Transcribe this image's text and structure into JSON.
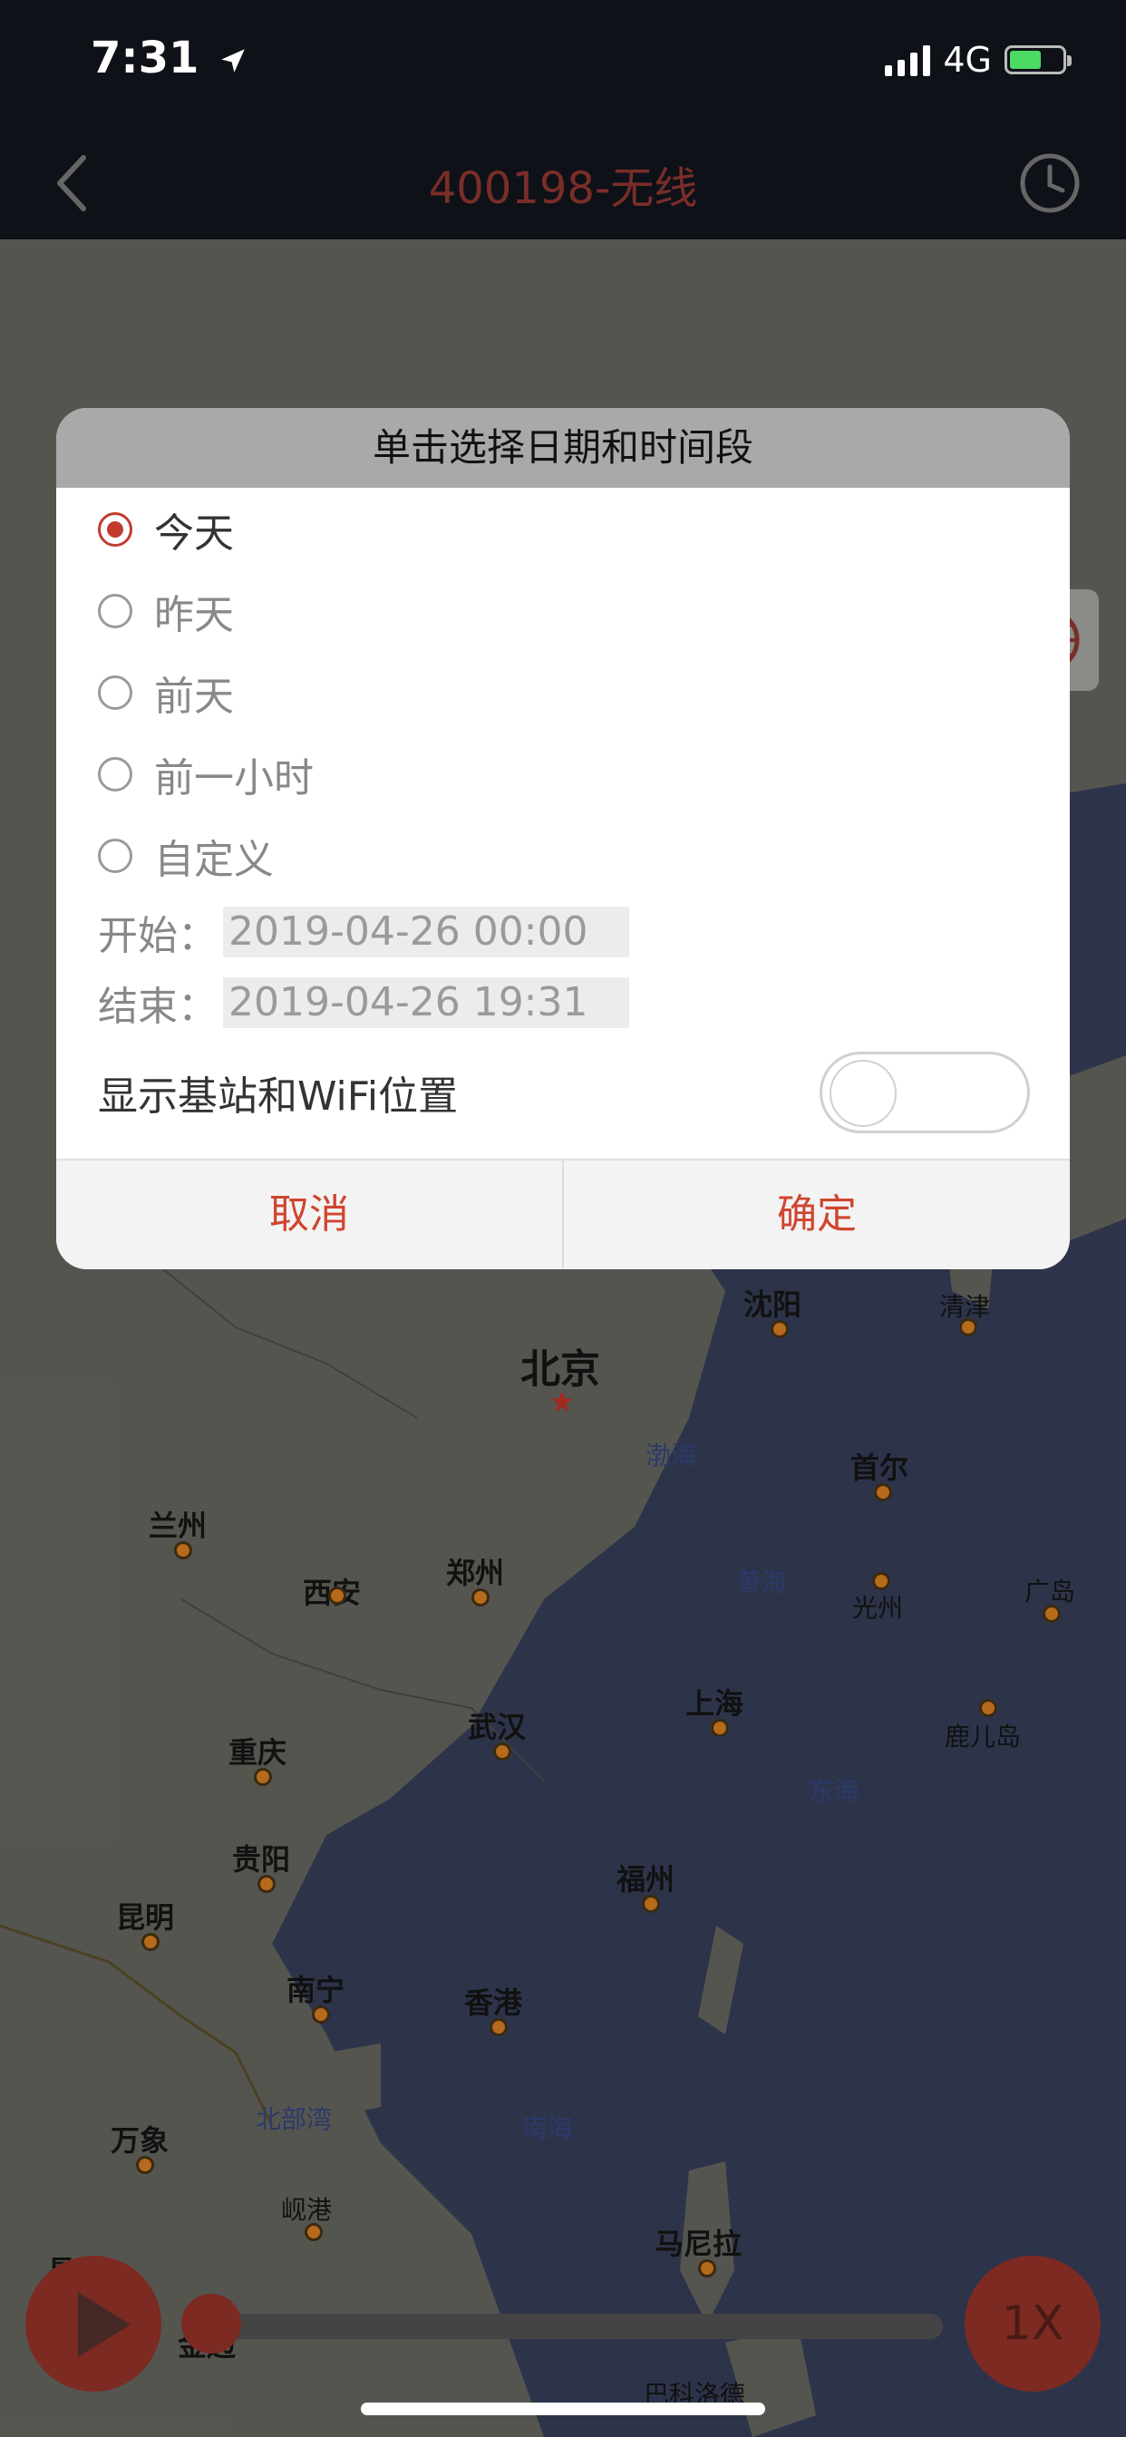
{
  "status_bar": {
    "time": "7:31",
    "network": "4G"
  },
  "nav": {
    "title": "400198-无线"
  },
  "dialog": {
    "title": "单击选择日期和时间段",
    "options": [
      {
        "label": "今天",
        "selected": true
      },
      {
        "label": "昨天",
        "selected": false
      },
      {
        "label": "前天",
        "selected": false
      },
      {
        "label": "前一小时",
        "selected": false
      },
      {
        "label": "自定义",
        "selected": false
      }
    ],
    "start": {
      "label": "开始：",
      "value": "2019-04-26 00:00"
    },
    "end": {
      "label": "结束：",
      "value": "2019-04-26 19:31"
    },
    "toggle": {
      "label": "显示基站和WiFi位置",
      "on": false
    },
    "cancel": "取消",
    "confirm": "确定"
  },
  "map": {
    "cities": [
      "北京",
      "沈阳",
      "清津",
      "首尔",
      "光州",
      "广岛",
      "鹿儿岛",
      "兰州",
      "西安",
      "郑州",
      "武汉",
      "上海",
      "重庆",
      "贵阳",
      "昆明",
      "南宁",
      "香港",
      "福州",
      "万象",
      "岘港",
      "马尼拉",
      "巴科洛德",
      "金边",
      "昌"
    ],
    "seas": [
      "渤海",
      "黄海",
      "东海",
      "北部湾",
      "南海"
    ]
  },
  "playback": {
    "speed": "1X",
    "progress": 0
  },
  "colors": {
    "accent": "#c23a2e",
    "button_text": "#d0452f",
    "nav_bg": "#0f1118"
  }
}
